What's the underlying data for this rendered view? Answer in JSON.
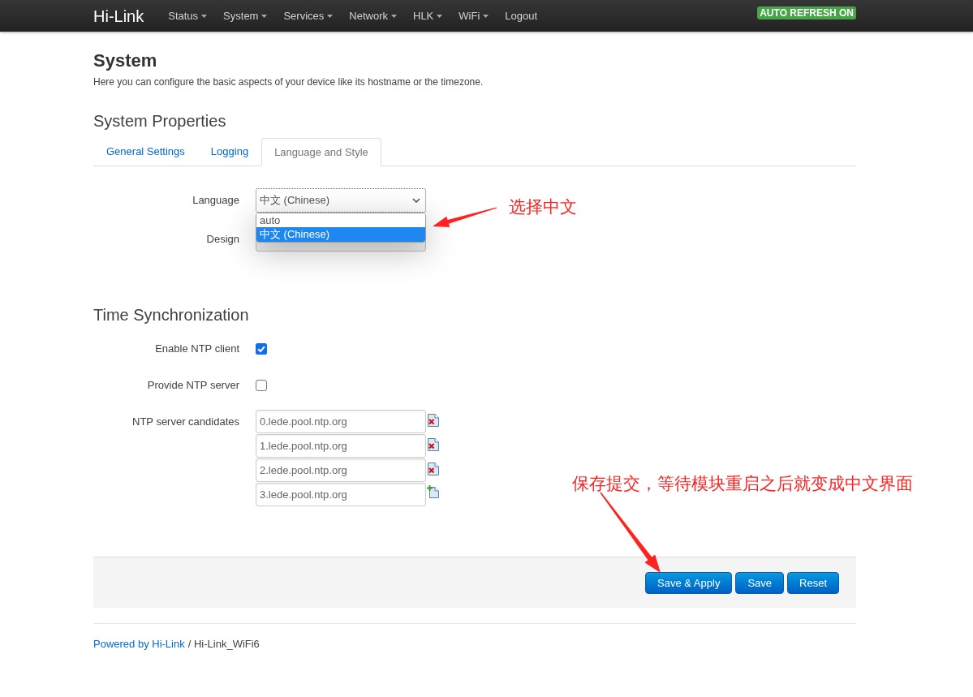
{
  "navbar": {
    "brand": "Hi-Link",
    "menu": [
      {
        "label": "Status",
        "kind": "dropdown"
      },
      {
        "label": "System",
        "kind": "dropdown"
      },
      {
        "label": "Services",
        "kind": "dropdown"
      },
      {
        "label": "Network",
        "kind": "dropdown"
      },
      {
        "label": "HLK",
        "kind": "dropdown"
      },
      {
        "label": "WiFi",
        "kind": "dropdown"
      },
      {
        "label": "Logout",
        "kind": "link"
      }
    ],
    "badge": "AUTO REFRESH ON"
  },
  "page": {
    "title": "System",
    "description": "Here you can configure the basic aspects of your device like its hostname or the timezone."
  },
  "section": {
    "title": "System Properties",
    "tabs": [
      {
        "label": "General Settings",
        "selected": false
      },
      {
        "label": "Logging",
        "selected": false
      },
      {
        "label": "Language and Style",
        "selected": true
      }
    ]
  },
  "language": {
    "label": "Language",
    "value": "中文 (Chinese)",
    "expanded": true,
    "options": [
      {
        "label": "auto",
        "selected": false
      },
      {
        "label": "中文 (Chinese)",
        "selected": true
      }
    ]
  },
  "design": {
    "label": "Design"
  },
  "time_sync": {
    "title": "Time Synchronization",
    "rows": [
      {
        "kind": "checkbox",
        "label": "Enable NTP client",
        "checked": true
      },
      {
        "kind": "checkbox",
        "label": "Provide NTP server",
        "checked": false
      },
      {
        "kind": "list",
        "label": "NTP server candidates",
        "entries": [
          {
            "value": "0.lede.pool.ntp.org",
            "kind": "remove"
          },
          {
            "value": "1.lede.pool.ntp.org",
            "kind": "remove"
          },
          {
            "value": "2.lede.pool.ntp.org",
            "kind": "remove"
          },
          {
            "value": "3.lede.pool.ntp.org",
            "kind": "add"
          }
        ]
      }
    ]
  },
  "actions": [
    {
      "label": "Save & Apply"
    },
    {
      "label": "Save"
    },
    {
      "label": "Reset"
    }
  ],
  "footer": {
    "link": "Powered by Hi-Link",
    "text": "/ Hi-Link_WiFi6"
  },
  "annotations": [
    {
      "text": "选择中文"
    },
    {
      "text": "保存提交，等待模块重启之后就变成中文界面"
    }
  ]
}
